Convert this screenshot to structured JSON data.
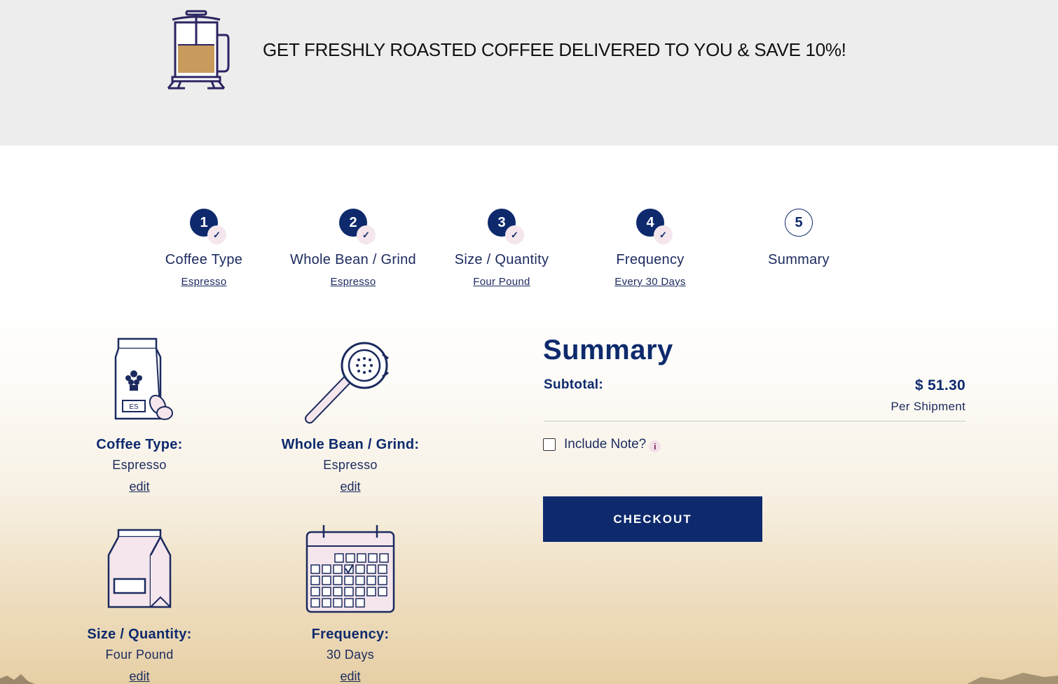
{
  "banner": {
    "headline": "GET FRESHLY ROASTED COFFEE DELIVERED TO YOU & SAVE 10%!"
  },
  "steps": [
    {
      "number": "1",
      "label": "Coffee Type",
      "selection": "Espresso",
      "complete": true
    },
    {
      "number": "2",
      "label": "Whole Bean / Grind",
      "selection": "Espresso",
      "complete": true
    },
    {
      "number": "3",
      "label": "Size / Quantity",
      "selection": "Four Pound",
      "complete": true
    },
    {
      "number": "4",
      "label": "Frequency",
      "selection": "Every 30 Days",
      "complete": true
    },
    {
      "number": "5",
      "label": "Summary",
      "selection": "",
      "complete": false
    }
  ],
  "tiles": [
    {
      "title": "Coffee Type:",
      "value": "Espresso",
      "edit": "edit",
      "icon": "coffee-bag-icon"
    },
    {
      "title": "Whole Bean / Grind:",
      "value": "Espresso",
      "edit": "edit",
      "icon": "portafilter-icon"
    },
    {
      "title": "Size / Quantity:",
      "value": "Four Pound",
      "edit": "edit",
      "icon": "bag-icon"
    },
    {
      "title": "Frequency:",
      "value": "30 Days",
      "edit": "edit",
      "icon": "calendar-icon"
    }
  ],
  "coffee_bag_label": "ES",
  "summary": {
    "heading": "Summary",
    "subtotal_label": "Subtotal:",
    "price": "$ 51.30",
    "per": "Per Shipment",
    "note_label": "Include Note?",
    "info": "i",
    "checkout": "CHECKOUT"
  },
  "colors": {
    "navy": "#0e2a6d",
    "banner_bg": "#eeeded",
    "pink": "#f4e6ec",
    "coffee": "#c89a5b"
  }
}
